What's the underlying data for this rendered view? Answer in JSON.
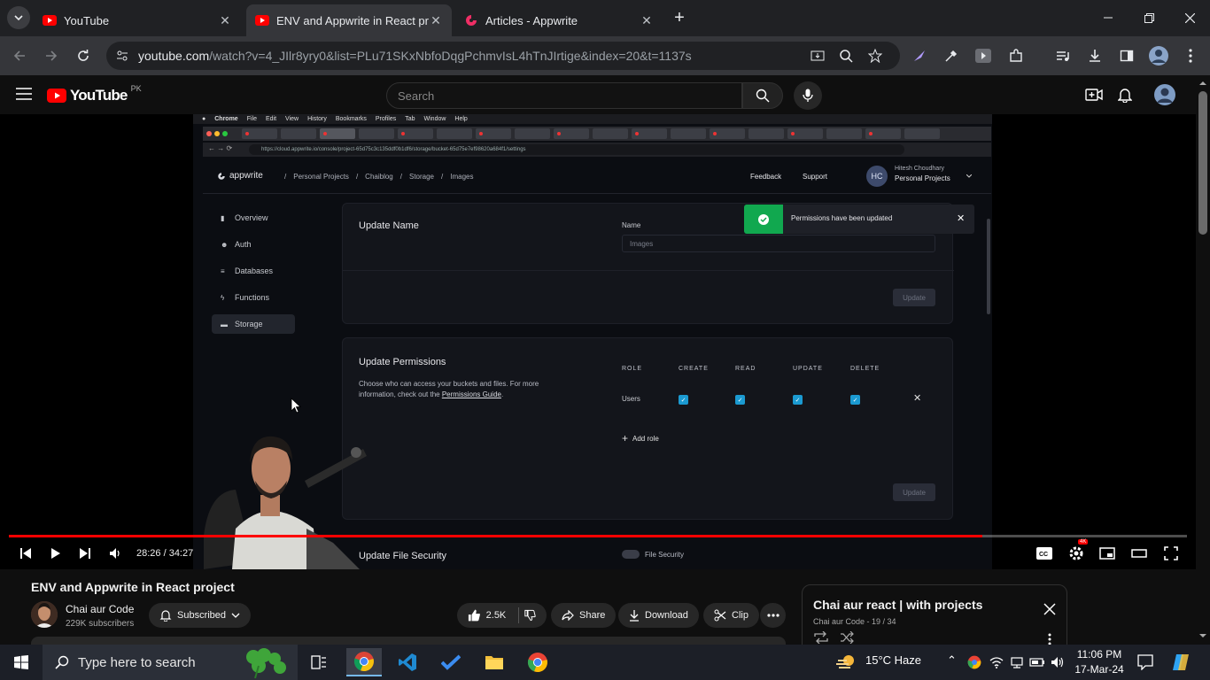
{
  "browser": {
    "tabs": [
      {
        "title": "YouTube",
        "active": false
      },
      {
        "title": "ENV and Appwrite in React proj",
        "active": true
      },
      {
        "title": "Articles - Appwrite",
        "active": false
      }
    ],
    "new_tab_glyph": "+",
    "url_host": "youtube.com",
    "url_path": "/watch?v=4_JIlr8yry0&list=PLu71SKxNbfoDqgPchmvIsL4hTnJIrtige&index=20&t=1137s"
  },
  "youtube": {
    "logo_text": "YouTube",
    "country": "PK",
    "search_placeholder": "Search"
  },
  "video_content": {
    "mac_menu": [
      "Chrome",
      "File",
      "Edit",
      "View",
      "History",
      "Bookmarks",
      "Profiles",
      "Tab",
      "Window",
      "Help"
    ],
    "url": "https://cloud.appwrite.io/console/project-65d75c3c135ddf0b1df6/storage/bucket-65d75e7ef98620a684f1/settings",
    "app": {
      "logo": "appwrite",
      "breadcrumbs": [
        "Personal Projects",
        "Chaiblog",
        "Storage",
        "Images"
      ],
      "feedback": "Feedback",
      "support": "Support",
      "user_initials": "HC",
      "user_name": "Hitesh Choudhary",
      "user_org": "Personal Projects"
    },
    "sidebar": [
      {
        "label": "Overview",
        "active": false
      },
      {
        "label": "Auth",
        "active": false
      },
      {
        "label": "Databases",
        "active": false
      },
      {
        "label": "Functions",
        "active": false
      },
      {
        "label": "Storage",
        "active": true
      }
    ],
    "update_name": {
      "title": "Update Name",
      "field_label": "Name",
      "field_value": "Images",
      "button": "Update"
    },
    "toast": "Permissions have been updated",
    "update_permissions": {
      "title": "Update Permissions",
      "desc": "Choose who can access your buckets and files. For more information, check out the ",
      "link": "Permissions Guide",
      "columns": [
        "ROLE",
        "CREATE",
        "READ",
        "UPDATE",
        "DELETE"
      ],
      "role": "Users",
      "add_role": "Add role",
      "button": "Update"
    },
    "next_section": "Update File Security",
    "next_toggle": "File Security"
  },
  "player": {
    "time": "28:26 / 34:27",
    "progress": 0.826
  },
  "below": {
    "title": "ENV and Appwrite in React project",
    "channel": "Chai aur Code",
    "subscribers": "229K subscribers",
    "subscribed": "Subscribed",
    "likes": "2.5K",
    "share": "Share",
    "download": "Download",
    "clip": "Clip",
    "playlist_title": "Chai aur react | with projects",
    "playlist_meta": "Chai aur Code - 19 / 34"
  },
  "taskbar": {
    "search_placeholder": "Type here to search",
    "weather": "15°C  Haze",
    "time": "11:06 PM",
    "date": "17-Mar-24"
  },
  "colors": {
    "accent_red": "#ff0000",
    "toast_green": "#11a84f",
    "checkbox_blue": "#1b9ad1"
  }
}
